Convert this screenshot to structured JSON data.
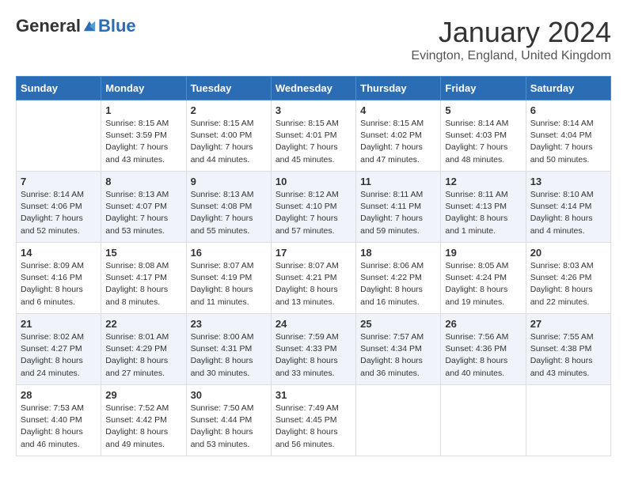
{
  "logo": {
    "general": "General",
    "blue": "Blue"
  },
  "title": "January 2024",
  "location": "Evington, England, United Kingdom",
  "days_of_week": [
    "Sunday",
    "Monday",
    "Tuesday",
    "Wednesday",
    "Thursday",
    "Friday",
    "Saturday"
  ],
  "weeks": [
    [
      {
        "day": "",
        "sunrise": "",
        "sunset": "",
        "daylight": ""
      },
      {
        "day": "1",
        "sunrise": "Sunrise: 8:15 AM",
        "sunset": "Sunset: 3:59 PM",
        "daylight": "Daylight: 7 hours and 43 minutes."
      },
      {
        "day": "2",
        "sunrise": "Sunrise: 8:15 AM",
        "sunset": "Sunset: 4:00 PM",
        "daylight": "Daylight: 7 hours and 44 minutes."
      },
      {
        "day": "3",
        "sunrise": "Sunrise: 8:15 AM",
        "sunset": "Sunset: 4:01 PM",
        "daylight": "Daylight: 7 hours and 45 minutes."
      },
      {
        "day": "4",
        "sunrise": "Sunrise: 8:15 AM",
        "sunset": "Sunset: 4:02 PM",
        "daylight": "Daylight: 7 hours and 47 minutes."
      },
      {
        "day": "5",
        "sunrise": "Sunrise: 8:14 AM",
        "sunset": "Sunset: 4:03 PM",
        "daylight": "Daylight: 7 hours and 48 minutes."
      },
      {
        "day": "6",
        "sunrise": "Sunrise: 8:14 AM",
        "sunset": "Sunset: 4:04 PM",
        "daylight": "Daylight: 7 hours and 50 minutes."
      }
    ],
    [
      {
        "day": "7",
        "sunrise": "Sunrise: 8:14 AM",
        "sunset": "Sunset: 4:06 PM",
        "daylight": "Daylight: 7 hours and 52 minutes."
      },
      {
        "day": "8",
        "sunrise": "Sunrise: 8:13 AM",
        "sunset": "Sunset: 4:07 PM",
        "daylight": "Daylight: 7 hours and 53 minutes."
      },
      {
        "day": "9",
        "sunrise": "Sunrise: 8:13 AM",
        "sunset": "Sunset: 4:08 PM",
        "daylight": "Daylight: 7 hours and 55 minutes."
      },
      {
        "day": "10",
        "sunrise": "Sunrise: 8:12 AM",
        "sunset": "Sunset: 4:10 PM",
        "daylight": "Daylight: 7 hours and 57 minutes."
      },
      {
        "day": "11",
        "sunrise": "Sunrise: 8:11 AM",
        "sunset": "Sunset: 4:11 PM",
        "daylight": "Daylight: 7 hours and 59 minutes."
      },
      {
        "day": "12",
        "sunrise": "Sunrise: 8:11 AM",
        "sunset": "Sunset: 4:13 PM",
        "daylight": "Daylight: 8 hours and 1 minute."
      },
      {
        "day": "13",
        "sunrise": "Sunrise: 8:10 AM",
        "sunset": "Sunset: 4:14 PM",
        "daylight": "Daylight: 8 hours and 4 minutes."
      }
    ],
    [
      {
        "day": "14",
        "sunrise": "Sunrise: 8:09 AM",
        "sunset": "Sunset: 4:16 PM",
        "daylight": "Daylight: 8 hours and 6 minutes."
      },
      {
        "day": "15",
        "sunrise": "Sunrise: 8:08 AM",
        "sunset": "Sunset: 4:17 PM",
        "daylight": "Daylight: 8 hours and 8 minutes."
      },
      {
        "day": "16",
        "sunrise": "Sunrise: 8:07 AM",
        "sunset": "Sunset: 4:19 PM",
        "daylight": "Daylight: 8 hours and 11 minutes."
      },
      {
        "day": "17",
        "sunrise": "Sunrise: 8:07 AM",
        "sunset": "Sunset: 4:21 PM",
        "daylight": "Daylight: 8 hours and 13 minutes."
      },
      {
        "day": "18",
        "sunrise": "Sunrise: 8:06 AM",
        "sunset": "Sunset: 4:22 PM",
        "daylight": "Daylight: 8 hours and 16 minutes."
      },
      {
        "day": "19",
        "sunrise": "Sunrise: 8:05 AM",
        "sunset": "Sunset: 4:24 PM",
        "daylight": "Daylight: 8 hours and 19 minutes."
      },
      {
        "day": "20",
        "sunrise": "Sunrise: 8:03 AM",
        "sunset": "Sunset: 4:26 PM",
        "daylight": "Daylight: 8 hours and 22 minutes."
      }
    ],
    [
      {
        "day": "21",
        "sunrise": "Sunrise: 8:02 AM",
        "sunset": "Sunset: 4:27 PM",
        "daylight": "Daylight: 8 hours and 24 minutes."
      },
      {
        "day": "22",
        "sunrise": "Sunrise: 8:01 AM",
        "sunset": "Sunset: 4:29 PM",
        "daylight": "Daylight: 8 hours and 27 minutes."
      },
      {
        "day": "23",
        "sunrise": "Sunrise: 8:00 AM",
        "sunset": "Sunset: 4:31 PM",
        "daylight": "Daylight: 8 hours and 30 minutes."
      },
      {
        "day": "24",
        "sunrise": "Sunrise: 7:59 AM",
        "sunset": "Sunset: 4:33 PM",
        "daylight": "Daylight: 8 hours and 33 minutes."
      },
      {
        "day": "25",
        "sunrise": "Sunrise: 7:57 AM",
        "sunset": "Sunset: 4:34 PM",
        "daylight": "Daylight: 8 hours and 36 minutes."
      },
      {
        "day": "26",
        "sunrise": "Sunrise: 7:56 AM",
        "sunset": "Sunset: 4:36 PM",
        "daylight": "Daylight: 8 hours and 40 minutes."
      },
      {
        "day": "27",
        "sunrise": "Sunrise: 7:55 AM",
        "sunset": "Sunset: 4:38 PM",
        "daylight": "Daylight: 8 hours and 43 minutes."
      }
    ],
    [
      {
        "day": "28",
        "sunrise": "Sunrise: 7:53 AM",
        "sunset": "Sunset: 4:40 PM",
        "daylight": "Daylight: 8 hours and 46 minutes."
      },
      {
        "day": "29",
        "sunrise": "Sunrise: 7:52 AM",
        "sunset": "Sunset: 4:42 PM",
        "daylight": "Daylight: 8 hours and 49 minutes."
      },
      {
        "day": "30",
        "sunrise": "Sunrise: 7:50 AM",
        "sunset": "Sunset: 4:44 PM",
        "daylight": "Daylight: 8 hours and 53 minutes."
      },
      {
        "day": "31",
        "sunrise": "Sunrise: 7:49 AM",
        "sunset": "Sunset: 4:45 PM",
        "daylight": "Daylight: 8 hours and 56 minutes."
      },
      {
        "day": "",
        "sunrise": "",
        "sunset": "",
        "daylight": ""
      },
      {
        "day": "",
        "sunrise": "",
        "sunset": "",
        "daylight": ""
      },
      {
        "day": "",
        "sunrise": "",
        "sunset": "",
        "daylight": ""
      }
    ]
  ]
}
